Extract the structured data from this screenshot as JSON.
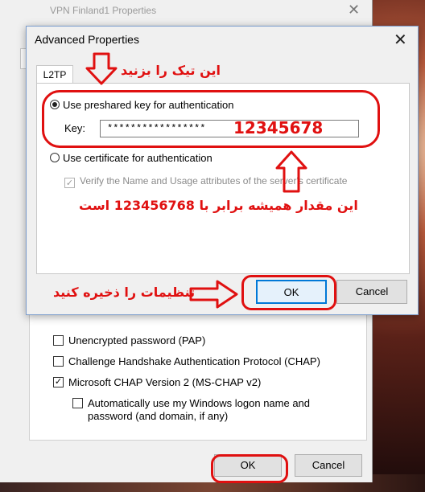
{
  "back_dialog": {
    "title": "VPN Finland1 Properties",
    "checkboxes": [
      {
        "label": "Unencrypted password (PAP)",
        "checked": false
      },
      {
        "label": "Challenge Handshake Authentication Protocol (CHAP)",
        "checked": false
      },
      {
        "label": "Microsoft CHAP Version 2 (MS-CHAP v2)",
        "checked": true
      }
    ],
    "sub_checkbox": {
      "label_line1": "Automatically use my Windows logon name and",
      "label_line2": "password (and domain, if any)",
      "checked": false
    },
    "ok_label": "OK",
    "cancel_label": "Cancel"
  },
  "front_dialog": {
    "title": "Advanced Properties",
    "tab_label": "L2TP",
    "radio_psk_label": "Use preshared key for authentication",
    "key_label": "Key:",
    "key_value": "*****************",
    "radio_cert_label": "Use certificate for authentication",
    "verify_label": "Verify the Name and Usage attributes of the server's certificate",
    "ok_label": "OK",
    "cancel_label": "Cancel"
  },
  "annotations": {
    "tick_instruction": "این تیک را بزنید",
    "key_value_overlay": "12345678",
    "value_note": "این مقدار همیشه برابر با 123456768 است",
    "save_instruction": "تنظیمات را ذخیره کنید"
  },
  "colors": {
    "annotation_red": "#e01010",
    "ok_focus": "#0078d7"
  }
}
